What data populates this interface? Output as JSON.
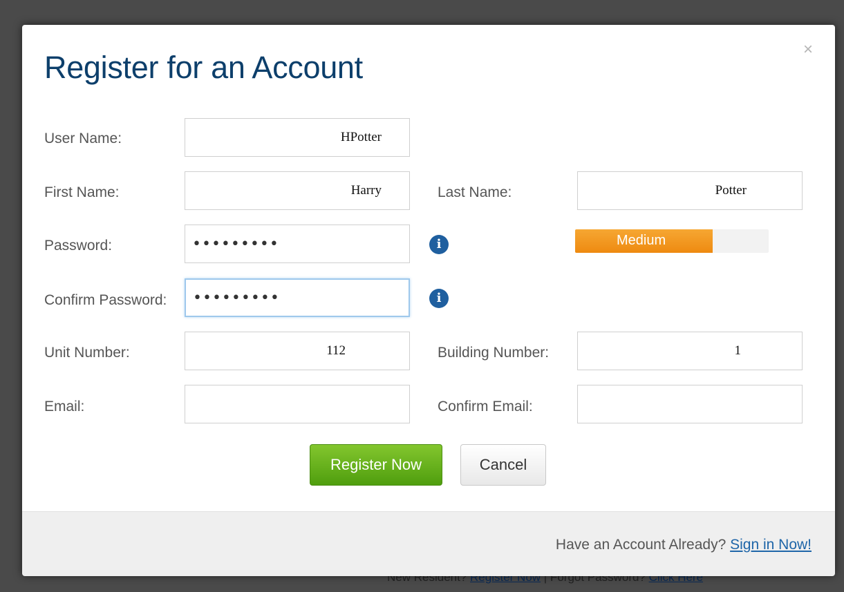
{
  "background": {
    "footer_prefix": "New Resident?",
    "footer_link1": "Register Now",
    "footer_sep": "|",
    "footer_mid": "Forgot Password?",
    "footer_link2": "Click Here"
  },
  "modal": {
    "title": "Register for an Account",
    "close_glyph": "×"
  },
  "form": {
    "username_label": "User Name:",
    "username_value": "HPotter",
    "firstname_label": "First Name:",
    "firstname_value": "Harry",
    "lastname_label": "Last Name:",
    "lastname_value": "Potter",
    "password_label": "Password:",
    "password_value": "•••••••••",
    "confirm_password_label": "Confirm Password:",
    "confirm_password_value": "•••••••••",
    "unit_label": "Unit Number:",
    "unit_value": "112",
    "building_label": "Building Number:",
    "building_value": "1",
    "email_label": "Email:",
    "email_value": "",
    "confirm_email_label": "Confirm Email:",
    "confirm_email_value": "",
    "info_glyph": "i",
    "strength_label": "Medium",
    "strength_level": 0.71,
    "strength_color": "#f09417"
  },
  "actions": {
    "register_label": "Register Now",
    "cancel_label": "Cancel"
  },
  "footer": {
    "prompt": "Have an Account Already?",
    "link": "Sign in Now!"
  },
  "colors": {
    "title": "#0d3f6b",
    "register_green": "#5aa814",
    "link_blue": "#1e65a8",
    "info_blue": "#1f5f9f"
  }
}
